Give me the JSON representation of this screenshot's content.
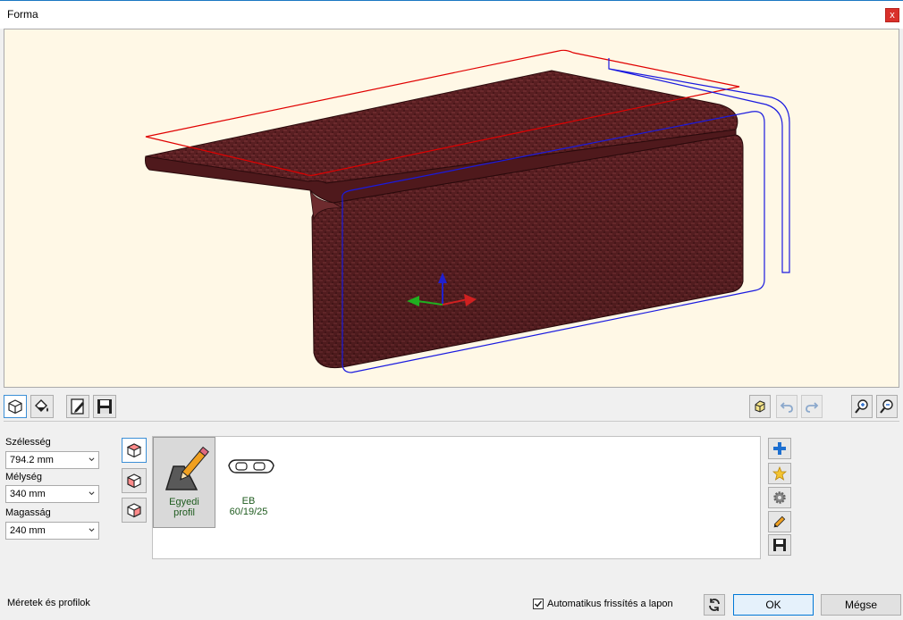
{
  "window": {
    "title": "Forma",
    "close_label": "x"
  },
  "toolbar": {
    "left": [
      {
        "icon": "cube-outline-icon",
        "active": true
      },
      {
        "icon": "paint-bucket-icon",
        "active": false
      },
      {
        "icon": "edit-document-icon",
        "active": false
      },
      {
        "icon": "save-icon",
        "active": false
      }
    ],
    "right": [
      {
        "icon": "cube-view-icon"
      },
      {
        "icon": "undo-icon",
        "disabled": true
      },
      {
        "icon": "redo-icon",
        "disabled": true
      },
      {
        "icon": "zoom-in-icon"
      },
      {
        "icon": "zoom-out-icon"
      }
    ]
  },
  "dimensions": {
    "width": {
      "label": "Szélesség",
      "value": "794.2 mm"
    },
    "depth": {
      "label": "Mélység",
      "value": "340 mm"
    },
    "height": {
      "label": "Magasság",
      "value": "240 mm"
    }
  },
  "profiles": [
    {
      "label_line1": "Egyedi",
      "label_line2": "profil",
      "selected": true,
      "icon": "custom-profile-pencil-icon"
    },
    {
      "label_line1": "EB",
      "label_line2": "60/19/25",
      "selected": false,
      "icon": "edge-profile-icon"
    }
  ],
  "right_actions": [
    {
      "icon": "add-plus-icon"
    },
    {
      "icon": "favorite-star-icon"
    },
    {
      "icon": "settings-gear-icon"
    },
    {
      "icon": "edit-pencil-icon"
    },
    {
      "icon": "save-icon"
    }
  ],
  "status": {
    "text": "Méretek és profilok"
  },
  "auto_refresh": {
    "label": "Automatikus frissítés a lapon",
    "checked": true
  },
  "buttons": {
    "ok": "OK",
    "cancel": "Mégse"
  },
  "colors": {
    "viewport_bg": "#fff8e6",
    "material": "#5a1f22",
    "outline_red": "#e00000",
    "outline_blue": "#1a1adf",
    "accent": "#0078d7"
  }
}
